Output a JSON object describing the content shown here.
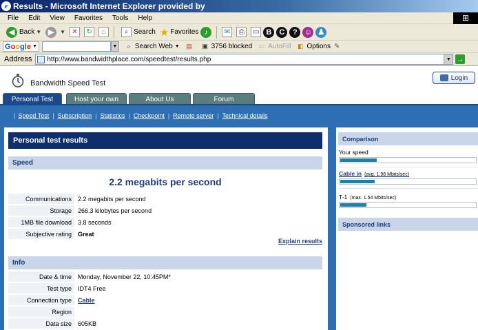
{
  "window": {
    "title": "Results - Microsoft Internet Explorer provided by"
  },
  "menu": [
    "File",
    "Edit",
    "View",
    "Favorites",
    "Tools",
    "Help"
  ],
  "toolbar": {
    "back": "Back",
    "search": "Search",
    "favorites": "Favorites"
  },
  "googlebar": {
    "logo": [
      "G",
      "o",
      "o",
      "g",
      "l",
      "e"
    ],
    "search_web": "Search Web",
    "blocked": "3756 blocked",
    "autofill": "AutoFill",
    "options": "Options"
  },
  "address": {
    "label": "Address",
    "url": "http://www.bandwidthplace.com/speedtest/results.php"
  },
  "site": {
    "title": "Bandwidth Speed Test",
    "login": "Login",
    "tabs": [
      "Personal Test",
      "Host your own",
      "About Us",
      "Forum"
    ],
    "subnav_lead": "|",
    "subnav": [
      "Speed Test",
      "Subscription",
      "Statistics",
      "Checkpoint",
      "Remote server",
      "Technical details"
    ]
  },
  "results": {
    "header": "Personal test results",
    "speed_section": "Speed",
    "speed_big": "2.2 megabits per second",
    "speed_rows": [
      {
        "k": "Communications",
        "v": "2.2 megabits per second"
      },
      {
        "k": "Storage",
        "v": "266.3 kilobytes per second"
      },
      {
        "k": "1MB file download",
        "v": "3.8 seconds"
      },
      {
        "k": "Subjective rating",
        "v": "Great"
      }
    ],
    "explain": "Explain results",
    "info_section": "Info",
    "info_rows": [
      {
        "k": "Date & time",
        "v": "Monday, November 22, 10:45PM*"
      },
      {
        "k": "Test type",
        "v": "IDT4 Free"
      },
      {
        "k": "Connection type",
        "v": "Cable"
      },
      {
        "k": "Region",
        "v": ""
      },
      {
        "k": "Data size",
        "v": "605KB"
      }
    ]
  },
  "comparison": {
    "header": "Comparison",
    "items": [
      {
        "label": "Your speed",
        "note": "",
        "fill": 0.27
      },
      {
        "label": "Cable in",
        "note": "(avg. 1.98 Mbits/sec)",
        "fill": 0.25
      },
      {
        "label": "T-1",
        "note": "(max. 1.54 Mbits/sec)",
        "fill": 0.19
      }
    ],
    "sponsored": "Sponsored links"
  },
  "colors": {
    "accent": "#2e6fb4",
    "dark_header": "#0e2f6c",
    "bar_fill": "#1e7fa8"
  }
}
